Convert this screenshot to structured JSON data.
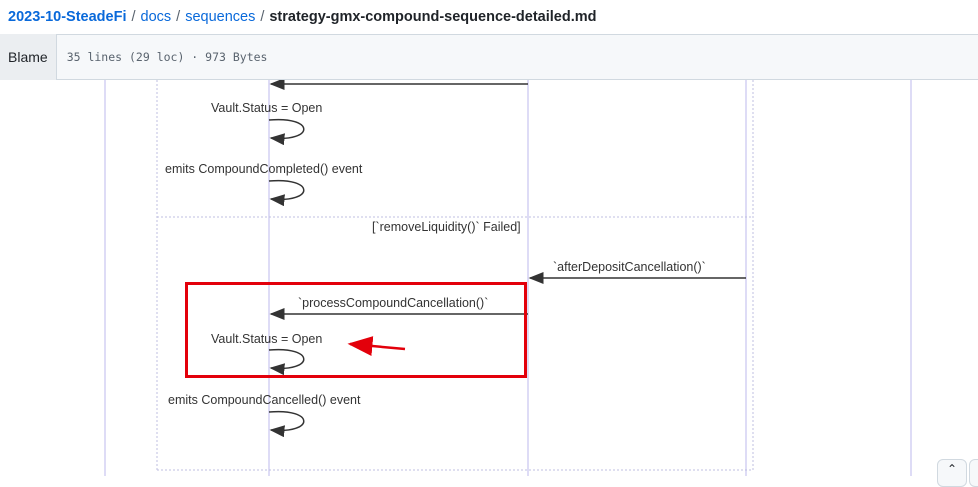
{
  "breadcrumb": {
    "repo": "2023-10-SteadeFi",
    "sep": "/",
    "folder1": "docs",
    "folder2": "sequences",
    "file": "strategy-gmx-compound-sequence-detailed.md"
  },
  "file_header": {
    "blame_label": "Blame",
    "info": "35 lines (29 loc) · 973 Bytes"
  },
  "diagram": {
    "labels": {
      "status_open_1": "Vault.Status = Open",
      "compound_completed": "emits CompoundCompleted() event",
      "loop_header": "[`removeLiquidity()` Failed]",
      "after_deposit_cancellation": "`afterDepositCancellation()`",
      "process_compound_cancellation": "`processCompoundCancellation()`",
      "status_open_2": "Vault.Status = Open",
      "compound_cancelled": "emits CompoundCancelled() event"
    },
    "highlight_color": "#e3000b",
    "lifeline_color": "#c7c4f0"
  },
  "controls": {
    "scroll_top_icon": "caret-up-icon",
    "scroll_top_glyph": "⌃"
  }
}
